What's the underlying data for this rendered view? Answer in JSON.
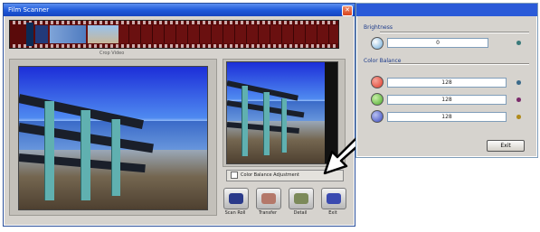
{
  "main_window": {
    "title": "Film Scanner",
    "close_glyph": "✕",
    "caption": "Crop   Video",
    "checkbox_label": "Color Balance Adjustment",
    "toolbar": [
      {
        "label": "Scan Roll",
        "icon": "camera-icon",
        "color": "#2a3a8a"
      },
      {
        "label": "Transfer",
        "icon": "photos-icon",
        "color": "#b4786a"
      },
      {
        "label": "Detail",
        "icon": "film-icon",
        "color": "#7c8a5a"
      },
      {
        "label": "Exit",
        "icon": "disk-icon",
        "color": "#3a4ab0"
      }
    ]
  },
  "adjust_panel": {
    "brightness_label": "Brightness",
    "brightness_value": "0",
    "color_balance_label": "Color Balance",
    "rows": [
      {
        "name": "red",
        "value": "128",
        "color": "#e03a2a"
      },
      {
        "name": "green",
        "value": "128",
        "color": "#4aa82a"
      },
      {
        "name": "blue",
        "value": "128",
        "color": "#3a4ac0"
      }
    ],
    "exit_label": "Exit"
  }
}
